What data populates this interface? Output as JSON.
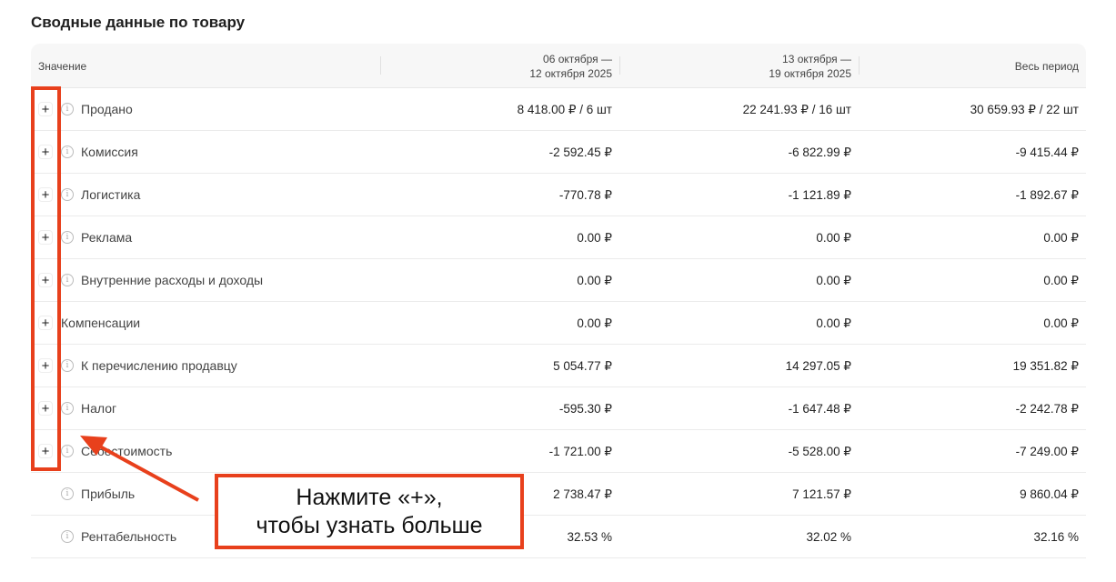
{
  "title": "Сводные данные по товару",
  "columns": [
    "Значение",
    [
      "06 октября —",
      "12 октября 2025"
    ],
    [
      "13 октября —",
      "19 октября 2025"
    ],
    "Весь период"
  ],
  "rows": [
    {
      "label": "Продано",
      "expand": true,
      "info": true,
      "values": [
        "8 418.00 ₽ / 6 шт",
        "22 241.93 ₽ / 16 шт",
        "30 659.93 ₽ / 22 шт"
      ]
    },
    {
      "label": "Комиссия",
      "expand": true,
      "info": true,
      "values": [
        "-2 592.45 ₽",
        "-6 822.99 ₽",
        "-9 415.44 ₽"
      ]
    },
    {
      "label": "Логистика",
      "expand": true,
      "info": true,
      "values": [
        "-770.78 ₽",
        "-1 121.89 ₽",
        "-1 892.67 ₽"
      ]
    },
    {
      "label": "Реклама",
      "expand": true,
      "info": true,
      "values": [
        "0.00 ₽",
        "0.00 ₽",
        "0.00 ₽"
      ]
    },
    {
      "label": "Внутренние расходы и доходы",
      "expand": true,
      "info": true,
      "values": [
        "0.00 ₽",
        "0.00 ₽",
        "0.00 ₽"
      ]
    },
    {
      "label": "Компенсации",
      "expand": true,
      "info": false,
      "values": [
        "0.00 ₽",
        "0.00 ₽",
        "0.00 ₽"
      ]
    },
    {
      "label": "К перечислению продавцу",
      "expand": true,
      "info": true,
      "values": [
        "5 054.77 ₽",
        "14 297.05 ₽",
        "19 351.82 ₽"
      ]
    },
    {
      "label": "Налог",
      "expand": true,
      "info": true,
      "values": [
        "-595.30 ₽",
        "-1 647.48 ₽",
        "-2 242.78 ₽"
      ]
    },
    {
      "label": "Себестоимость",
      "expand": true,
      "info": true,
      "values": [
        "-1 721.00 ₽",
        "-5 528.00 ₽",
        "-7 249.00 ₽"
      ]
    },
    {
      "label": "Прибыль",
      "expand": false,
      "info": true,
      "values": [
        "2 738.47 ₽",
        "7 121.57 ₽",
        "9 860.04 ₽"
      ]
    },
    {
      "label": "Рентабельность",
      "expand": false,
      "info": true,
      "values": [
        "32.53 %",
        "32.02 %",
        "32.16 %"
      ]
    }
  ],
  "callout": [
    "Нажмите «+»,",
    "чтобы узнать больше"
  ],
  "accent": "#e8401c"
}
